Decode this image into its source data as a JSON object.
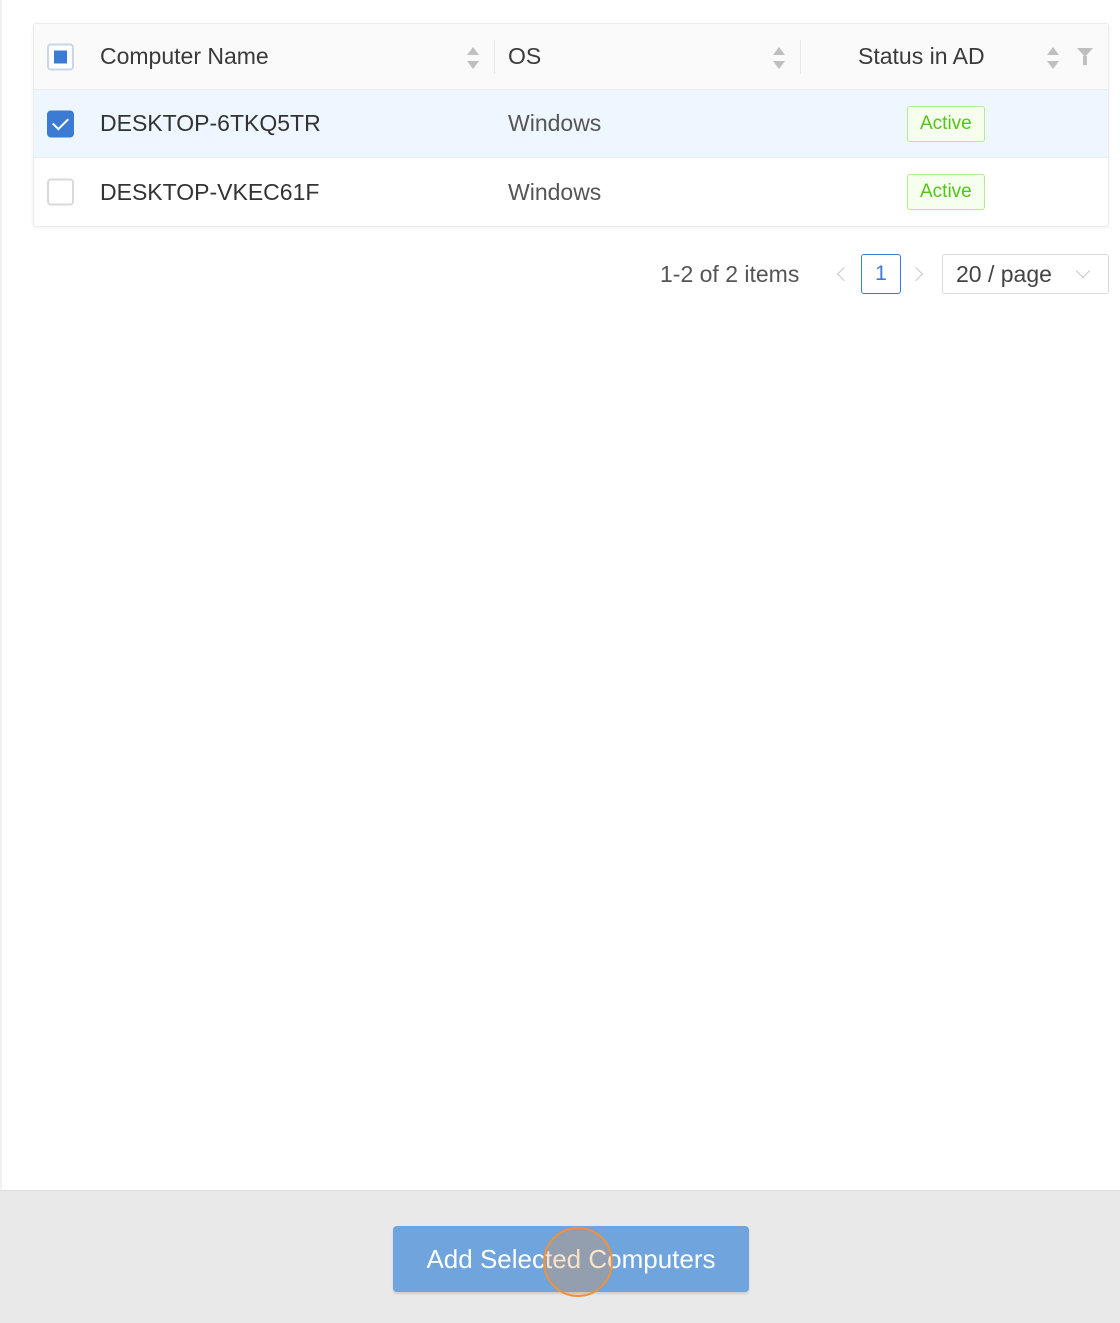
{
  "table": {
    "columns": [
      {
        "label": "Computer Name",
        "sortable": true
      },
      {
        "label": "OS",
        "sortable": true
      },
      {
        "label": "Status in AD",
        "sortable": true,
        "filterable": true
      }
    ],
    "select_all_state": "indeterminate",
    "rows": [
      {
        "name": "DESKTOP-6TKQ5TR",
        "os": "Windows",
        "status": "Active",
        "selected": true
      },
      {
        "name": "DESKTOP-VKEC61F",
        "os": "Windows",
        "status": "Active",
        "selected": false
      }
    ]
  },
  "pagination": {
    "total_text": "1-2 of 2 items",
    "current_page": "1",
    "page_size": "20 / page"
  },
  "footer": {
    "primary_button": "Add Selected Computers"
  },
  "colors": {
    "primary": "#3b7bd4",
    "button_bg": "#6fa4dc",
    "status_active": "#52c41a",
    "selected_row": "#eef6ff"
  }
}
